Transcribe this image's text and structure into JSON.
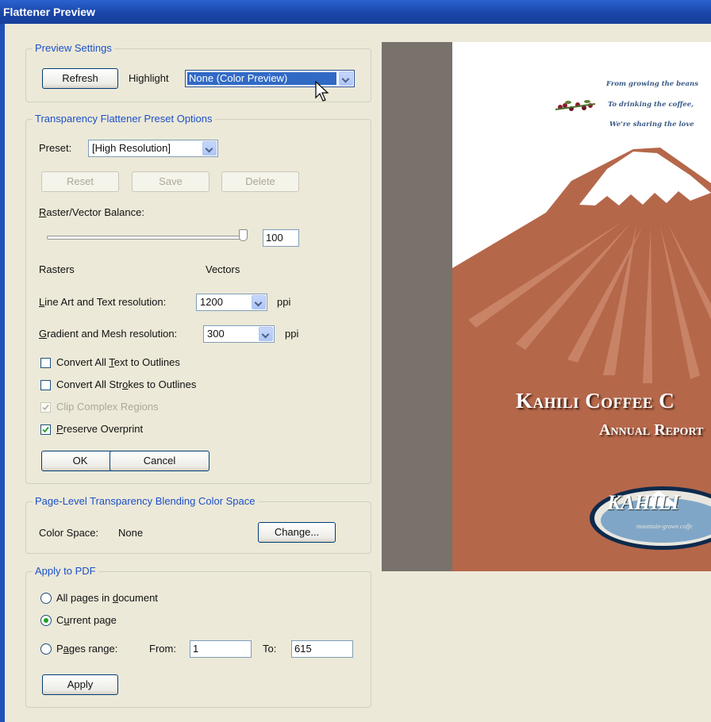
{
  "window": {
    "title": "Flattener Preview"
  },
  "preview_settings": {
    "legend": "Preview Settings",
    "refresh_label": "Refresh",
    "highlight_label": "Highlight",
    "highlight_value": "None (Color Preview)"
  },
  "preset_options": {
    "legend": "Transparency Flattener Preset Options",
    "preset_label": "Preset:",
    "preset_value": "[High Resolution]",
    "reset_label": "Reset",
    "save_label": "Save",
    "delete_label": "Delete",
    "balance_label": "Raster/Vector Balance:",
    "balance_value": "100",
    "rasters_label": "Rasters",
    "vectors_label": "Vectors",
    "line_art_label": "Line Art and Text resolution:",
    "line_art_value": "1200",
    "line_art_unit": "ppi",
    "gradient_label": "Gradient and Mesh resolution:",
    "gradient_value": "300",
    "gradient_unit": "ppi",
    "checkboxes": [
      {
        "label": "Convert All Text to Outlines",
        "checked": false,
        "enabled": true
      },
      {
        "label": "Convert All Strokes to Outlines",
        "checked": false,
        "enabled": true
      },
      {
        "label": "Clip Complex Regions",
        "checked": true,
        "enabled": false
      },
      {
        "label": "Preserve Overprint",
        "checked": true,
        "enabled": true
      }
    ],
    "ok_label": "OK",
    "cancel_label": "Cancel"
  },
  "blending": {
    "legend": "Page-Level Transparency Blending Color Space",
    "color_space_label": "Color Space:",
    "color_space_value": "None",
    "change_label": "Change..."
  },
  "apply_pdf": {
    "legend": "Apply to PDF",
    "options": [
      {
        "label": "All pages in document",
        "selected": false
      },
      {
        "label": "Current page",
        "selected": true
      },
      {
        "label": "Pages range:",
        "selected": false
      }
    ],
    "from_label": "From:",
    "from_value": "1",
    "to_label": "To:",
    "to_value": "615",
    "apply_label": "Apply"
  },
  "preview": {
    "motto_lines": [
      "From growing the beans",
      "To drinking the coffee,",
      "We're sharing the love"
    ],
    "company_title": "Kahili Coffee C",
    "report_title": "Annual Report",
    "logo_text": "KAHILI",
    "logo_tagline": "mountain-grown coffe"
  },
  "colors": {
    "title_bar": "#1f4fb8",
    "dialog_bg": "#ece9d8",
    "legend_text": "#1c50c9",
    "mountain": "#b5674a",
    "preview_bg": "#78716c"
  }
}
